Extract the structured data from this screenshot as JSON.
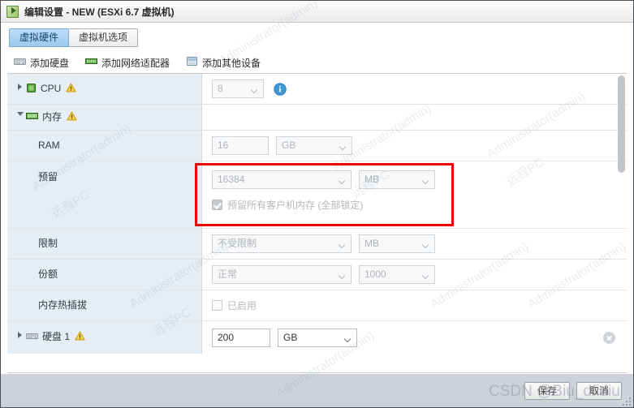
{
  "window": {
    "title": "编辑设置 - NEW (ESXi 6.7 虚拟机)",
    "icon": "vm-icon"
  },
  "tabs": [
    {
      "label": "虚拟硬件",
      "active": true
    },
    {
      "label": "虚拟机选项",
      "active": false
    }
  ],
  "toolbar": {
    "add_hard_disk": "添加硬盘",
    "add_network_adapter": "添加网络适配器",
    "add_other_device": "添加其他设备"
  },
  "rows": {
    "cpu": {
      "label": "CPU",
      "value": "8",
      "warning": true,
      "expanded": false,
      "info_tooltip": "i"
    },
    "memory": {
      "label": "内存",
      "warning": true,
      "expanded": true
    },
    "ram": {
      "label": "RAM",
      "value": "16",
      "unit": "GB"
    },
    "reservation": {
      "label": "预留",
      "value": "16384",
      "unit": "MB",
      "checkbox_label": "预留所有客户机内存 (全部锁定)",
      "checkbox_checked": true,
      "highlighted": true
    },
    "limit": {
      "label": "限制",
      "value": "不受限制",
      "unit": "MB"
    },
    "shares": {
      "label": "份额",
      "value": "正常",
      "amount": "1000"
    },
    "memory_hotplug": {
      "label": "内存热插拔",
      "checkbox_label": "已启用",
      "checkbox_checked": false
    },
    "hard_disk": {
      "label": "硬盘 1",
      "value": "200",
      "unit": "GB",
      "warning": true,
      "expanded": false,
      "remove": "×"
    }
  },
  "footer": {
    "save": "保存",
    "cancel": "取消"
  },
  "watermarks": {
    "user": "Administrator(admin)",
    "host": "远程PC",
    "csdn": "CSDN @Biu_dfidiu"
  },
  "colors": {
    "accent": "#9ccaee",
    "highlight": "#f20000",
    "label_bg": "#e6eef4",
    "footer_bg": "#ced2d8",
    "warning": "#f5c518"
  }
}
